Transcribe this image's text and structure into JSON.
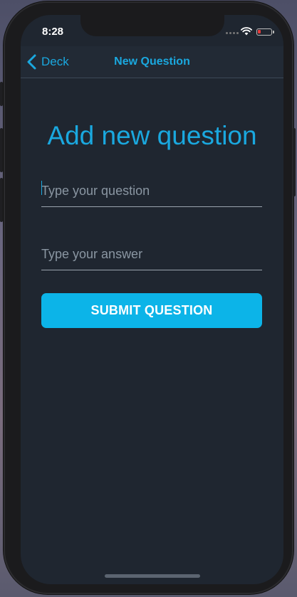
{
  "status_bar": {
    "time": "8:28",
    "icons": [
      "cellular-signal-icon",
      "wifi-icon",
      "battery-low-icon"
    ],
    "battery_color": "#e83a3a"
  },
  "nav": {
    "back_label": "Deck",
    "back_icon": "chevron-left-icon",
    "title": "New Question"
  },
  "main": {
    "heading": "Add new question",
    "question_field": {
      "value": "",
      "placeholder": "Type your question"
    },
    "answer_field": {
      "value": "",
      "placeholder": "Type your answer"
    },
    "submit_label": "SUBMIT QUESTION"
  },
  "colors": {
    "accent": "#1aa8df",
    "button": "#0cb4e8",
    "background": "#1f2630"
  }
}
